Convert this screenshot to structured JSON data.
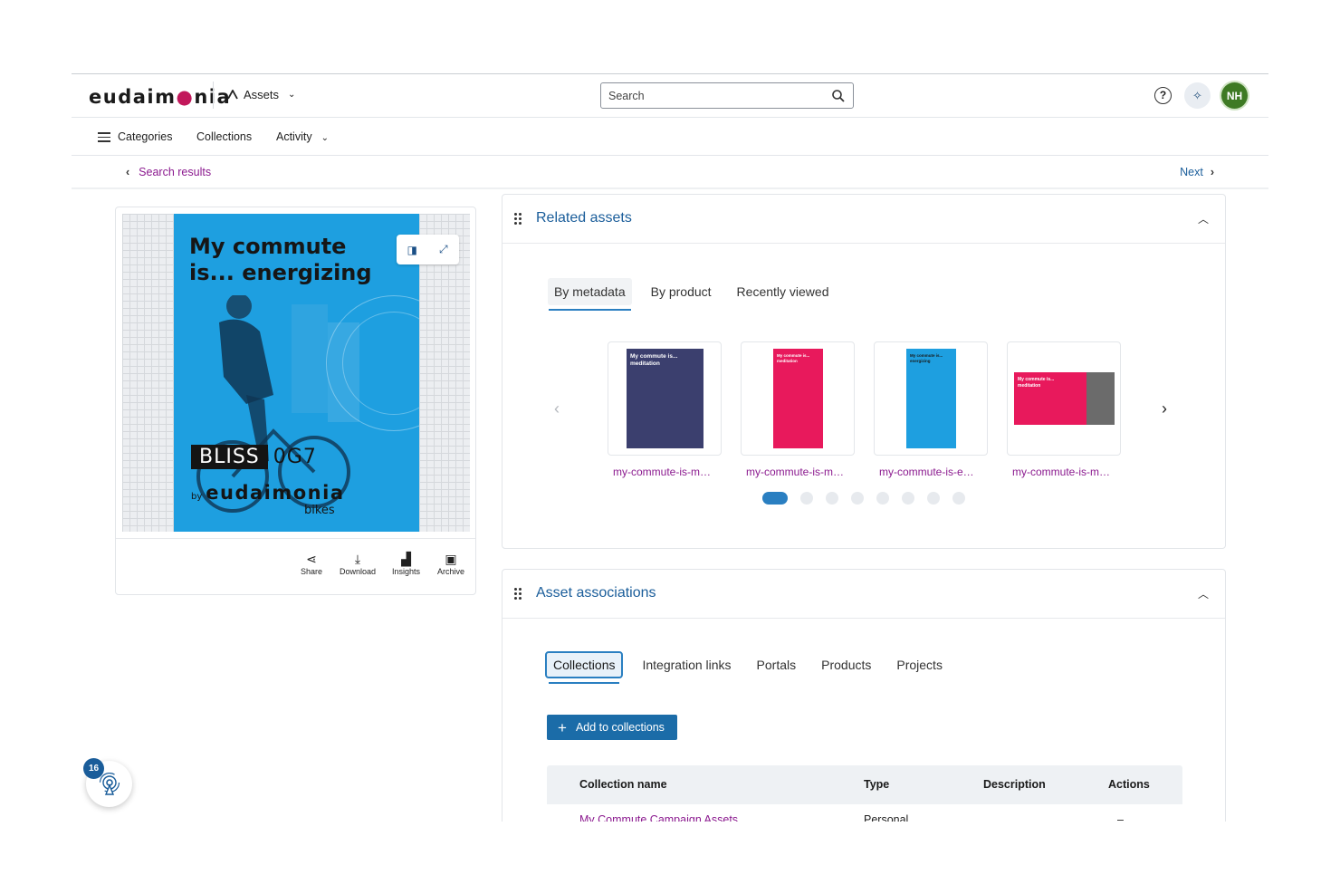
{
  "header": {
    "logo_text": "eudaimonia",
    "app_switcher_label": "Assets",
    "search_placeholder": "Search",
    "avatar_initials": "NH"
  },
  "subnav": {
    "categories": "Categories",
    "collections": "Collections",
    "activity": "Activity"
  },
  "breadcrumb": {
    "back_label": "Search results",
    "next_label": "Next"
  },
  "preview": {
    "poster_title": "My commute is... energizing",
    "poster_badge_left": "BLISS",
    "poster_badge_right": "0G7",
    "poster_brand_by": "by",
    "poster_brand_name": "eudaimonia",
    "poster_brand_sub": "bikes",
    "actions": [
      {
        "label": "Share",
        "icon": "share-icon"
      },
      {
        "label": "Download",
        "icon": "download-icon"
      },
      {
        "label": "Insights",
        "icon": "insights-icon"
      },
      {
        "label": "Archive",
        "icon": "archive-icon"
      }
    ]
  },
  "related_assets": {
    "title": "Related assets",
    "tabs": [
      "By metadata",
      "By product",
      "Recently viewed"
    ],
    "active_tab": "By metadata",
    "thumbnails": [
      {
        "label": "my-commute-is-m…",
        "mini_title": "My commute is... meditation",
        "color": "#3b3f6e"
      },
      {
        "label": "my-commute-is-m…",
        "mini_title": "My commute is... meditation",
        "color": "#e8195c"
      },
      {
        "label": "my-commute-is-e…",
        "mini_title": "My commute is... energizing",
        "color": "#1e9fe0"
      },
      {
        "label": "my-commute-is-m…",
        "mini_title": "My commute is... meditation",
        "color": "#e8195c"
      }
    ],
    "pages": 8,
    "current_page": 1
  },
  "asset_associations": {
    "title": "Asset associations",
    "tabs": [
      "Collections",
      "Integration links",
      "Portals",
      "Products",
      "Projects"
    ],
    "active_tab": "Collections",
    "add_button": "Add to collections",
    "table": {
      "columns": [
        "Collection name",
        "Type",
        "Description",
        "Actions"
      ],
      "rows": [
        {
          "name": "My Commute Campaign Assets",
          "type": "Personal",
          "description": "",
          "actions": "–"
        }
      ]
    }
  },
  "notifications": {
    "count": "16"
  },
  "colors": {
    "link_purple": "#8b1a8f",
    "accent_blue": "#1a5d9a",
    "button_blue": "#1b6ca8",
    "avatar_green": "#3e7a24"
  }
}
